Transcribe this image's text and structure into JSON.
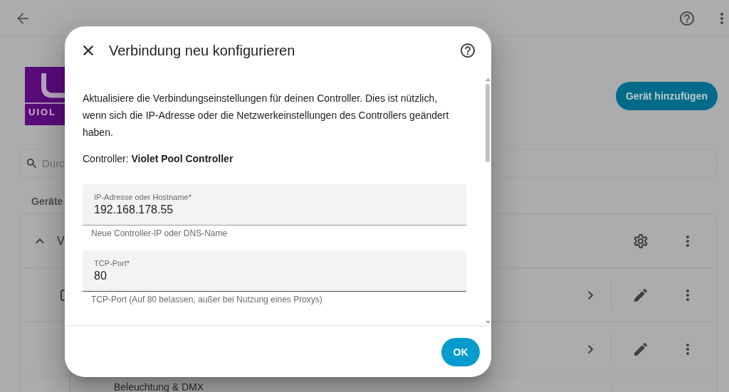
{
  "page": {
    "logo": {
      "text": "UIOL"
    },
    "add_button": {
      "label": "Gerät hinzufügen"
    },
    "search": {
      "placeholder": "Durc"
    },
    "section_label": "Geräte",
    "device_card": {
      "expanded": true,
      "title": "V",
      "rows": [
        {
          "kind": "device"
        },
        {
          "kind": "plain"
        },
        {
          "kind": "child",
          "label": "Beleuchtung & DMX"
        }
      ]
    }
  },
  "dialog": {
    "title": "Verbindung neu konfigurieren",
    "description": "Aktualisiere die Verbindungseinstellungen für deinen Controller. Dies ist nützlich, wenn sich die IP-Adresse oder die Netzwerkeinstellungen des Controllers geändert haben.",
    "controller_line": "Controller: **Violet Pool Controller**",
    "fields": [
      {
        "label": "IP-Adresse oder Hostname*",
        "value": "192.168.178.55",
        "helper": "Neue Controller-IP oder DNS-Name",
        "hovered": false
      },
      {
        "label": "TCP-Port*",
        "value": "80",
        "helper": "TCP-Port (Auf 80 belassen, außer bei Nutzung eines Proxys)",
        "hovered": true
      }
    ],
    "buttons": [
      {
        "label": "OK"
      }
    ]
  }
}
